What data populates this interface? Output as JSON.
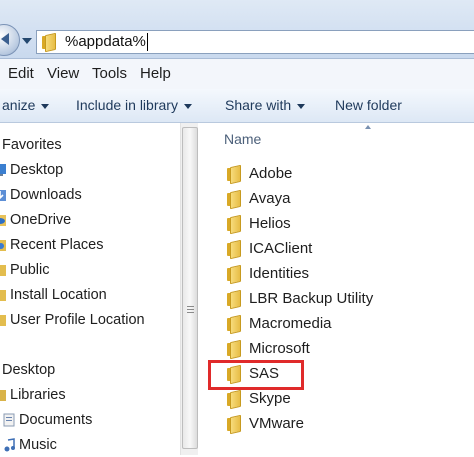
{
  "address_bar": {
    "path": "%appdata%"
  },
  "menu": [
    "Edit",
    "View",
    "Tools",
    "Help"
  ],
  "toolbar": {
    "organize_label": "anize",
    "include_label": "Include in library",
    "share_label": "Share with",
    "new_folder_label": "New folder"
  },
  "nav_pane": {
    "favorites_header": "Favorites",
    "favorites": [
      "Desktop",
      "Downloads",
      "OneDrive",
      "Recent Places",
      "Public",
      "Install Location",
      "User Profile Location"
    ],
    "desktop_header": "Desktop",
    "libraries_label": "Libraries",
    "libraries": [
      "Documents",
      "Music"
    ]
  },
  "content": {
    "column_header": "Name",
    "folders": [
      "Adobe",
      "Avaya",
      "Helios",
      "ICAClient",
      "Identities",
      "LBR Backup Utility",
      "Macromedia",
      "Microsoft",
      "SAS",
      "Skype",
      "VMware"
    ],
    "highlighted_folder": "SAS"
  },
  "colors": {
    "highlight": "#e02a2a",
    "folder": "#e7bd46",
    "toolbar_text": "#1e395b"
  }
}
